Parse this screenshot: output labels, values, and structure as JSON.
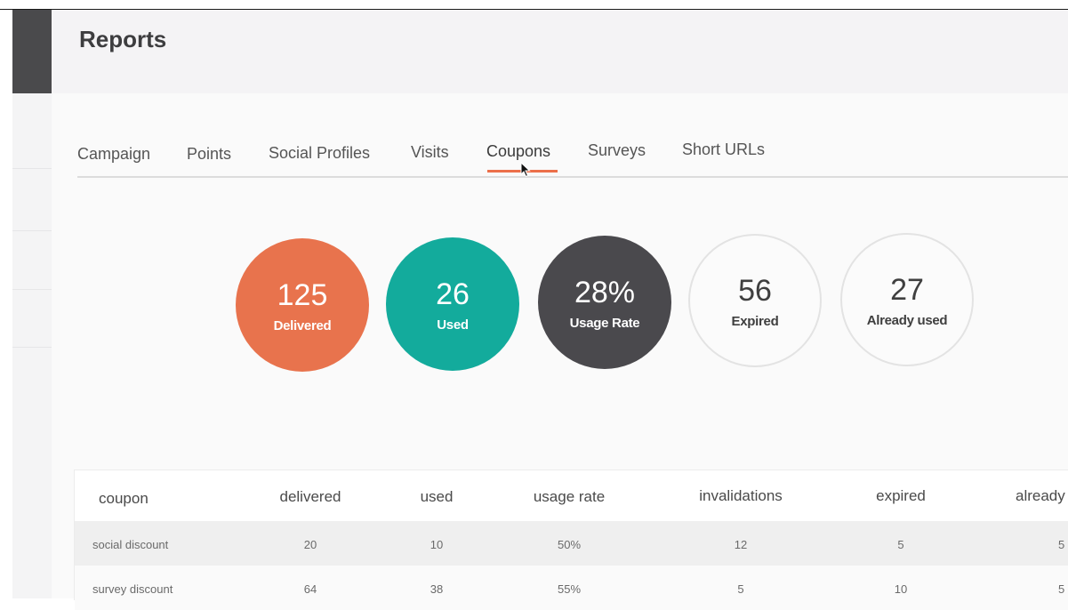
{
  "page": {
    "title": "Reports"
  },
  "tabs": [
    {
      "label": "Campaign"
    },
    {
      "label": "Points"
    },
    {
      "label": "Social Profiles"
    },
    {
      "label": "Visits"
    },
    {
      "label": "Coupons",
      "active": true
    },
    {
      "label": "Surveys"
    },
    {
      "label": "Short URLs"
    }
  ],
  "stats": {
    "delivered": {
      "value": "125",
      "label": "Delivered",
      "color": "#e8734d"
    },
    "used": {
      "value": "26",
      "label": "Used",
      "color": "#13ab9c"
    },
    "usage_rate": {
      "value": "28%",
      "label": "Usage Rate",
      "color": "#4a494d"
    },
    "expired": {
      "value": "56",
      "label": "Expired"
    },
    "already_used": {
      "value": "27",
      "label": "Already used"
    }
  },
  "table": {
    "headers": [
      "coupon",
      "delivered",
      "used",
      "usage rate",
      "invalidations",
      "expired",
      "already"
    ],
    "rows": [
      [
        "social discount",
        "20",
        "10",
        "50%",
        "12",
        "5",
        "5"
      ],
      [
        "survey discount",
        "64",
        "38",
        "55%",
        "5",
        "10",
        "5"
      ]
    ]
  },
  "colors": {
    "accent": "#ec6f4a"
  }
}
